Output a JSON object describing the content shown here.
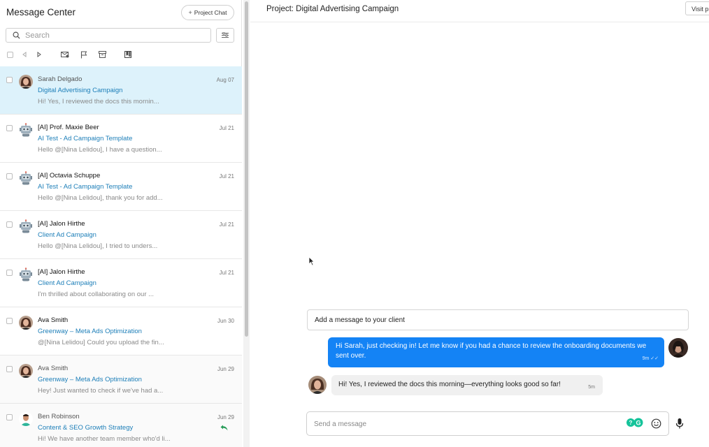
{
  "left_panel": {
    "title": "Message Center",
    "project_chat_label": "Project Chat",
    "search_placeholder": "Search"
  },
  "conversations": [
    {
      "name": "Sarah Delgado",
      "date": "Aug 07",
      "subject": "Digital Advertising Campaign",
      "preview": "Hi! Yes, I reviewed the docs this mornin...",
      "avatar": "woman-photo",
      "state": "active"
    },
    {
      "name": "[AI] Prof. Maxie Beer",
      "date": "Jul 21",
      "subject": "AI Test - Ad Campaign Template",
      "preview": "Hello @[Nina Lelidou], I have a question...",
      "avatar": "robot-icon",
      "state": "unread"
    },
    {
      "name": "[AI] Octavia Schuppe",
      "date": "Jul 21",
      "subject": "AI Test - Ad Campaign Template",
      "preview": "Hello @[Nina Lelidou], thank you for add...",
      "avatar": "robot-icon",
      "state": "unread"
    },
    {
      "name": "[AI] Jalon Hirthe",
      "date": "Jul 21",
      "subject": "Client Ad Campaign",
      "preview": "Hello @[Nina Lelidou], I tried to unders...",
      "avatar": "robot-icon",
      "state": "unread"
    },
    {
      "name": "[AI] Jalon Hirthe",
      "date": "Jul 21",
      "subject": "Client Ad Campaign",
      "preview": "I'm thrilled about collaborating on our ...",
      "avatar": "robot-icon",
      "state": "unread"
    },
    {
      "name": "Ava Smith",
      "date": "Jun 30",
      "subject": "Greenway – Meta Ads Optimization",
      "preview": "@[Nina Lelidou] Could you upload the fin...",
      "avatar": "woman-photo",
      "state": "unread"
    },
    {
      "name": "Ava Smith",
      "date": "Jun 29",
      "subject": "Greenway – Meta Ads Optimization",
      "preview": "Hey! Just wanted to check if we've had a...",
      "avatar": "woman-photo",
      "state": "read"
    },
    {
      "name": "Ben Robinson",
      "date": "Jun 29",
      "subject": "Content & SEO Growth Strategy",
      "preview": "Hi! We have another team member who'd li...",
      "avatar": "man-photo",
      "state": "read",
      "reply_icon": "reply-arrow-icon"
    }
  ],
  "chat": {
    "project_title": "Project: Digital Advertising Campaign",
    "visit_button_label": "Visit pr",
    "client_message_label": "Add a message to your client",
    "messages": [
      {
        "direction": "outgoing",
        "text": "Hi Sarah, just checking in! Let me know if you had a chance to review the onboarding documents we sent over.",
        "time": "9m"
      },
      {
        "direction": "incoming",
        "text": "Hi! Yes, I reviewed the docs this morning—everything looks good so far!",
        "time": "5m"
      }
    ],
    "composer_placeholder": "Send a message"
  },
  "colors": {
    "accent_blue": "#1483f5",
    "link_blue": "#1c7eb8",
    "active_row": "#ddf2fb",
    "grammarly_green": "#15c39a"
  },
  "icons": [
    "search-icon",
    "filter-icon",
    "prev-icon",
    "next-icon",
    "mark-unread-icon",
    "flag-icon",
    "archive-icon",
    "bookmark-icon",
    "robot-icon",
    "reply-arrow-icon",
    "emoji-icon",
    "microphone-icon",
    "cursor-icon"
  ]
}
